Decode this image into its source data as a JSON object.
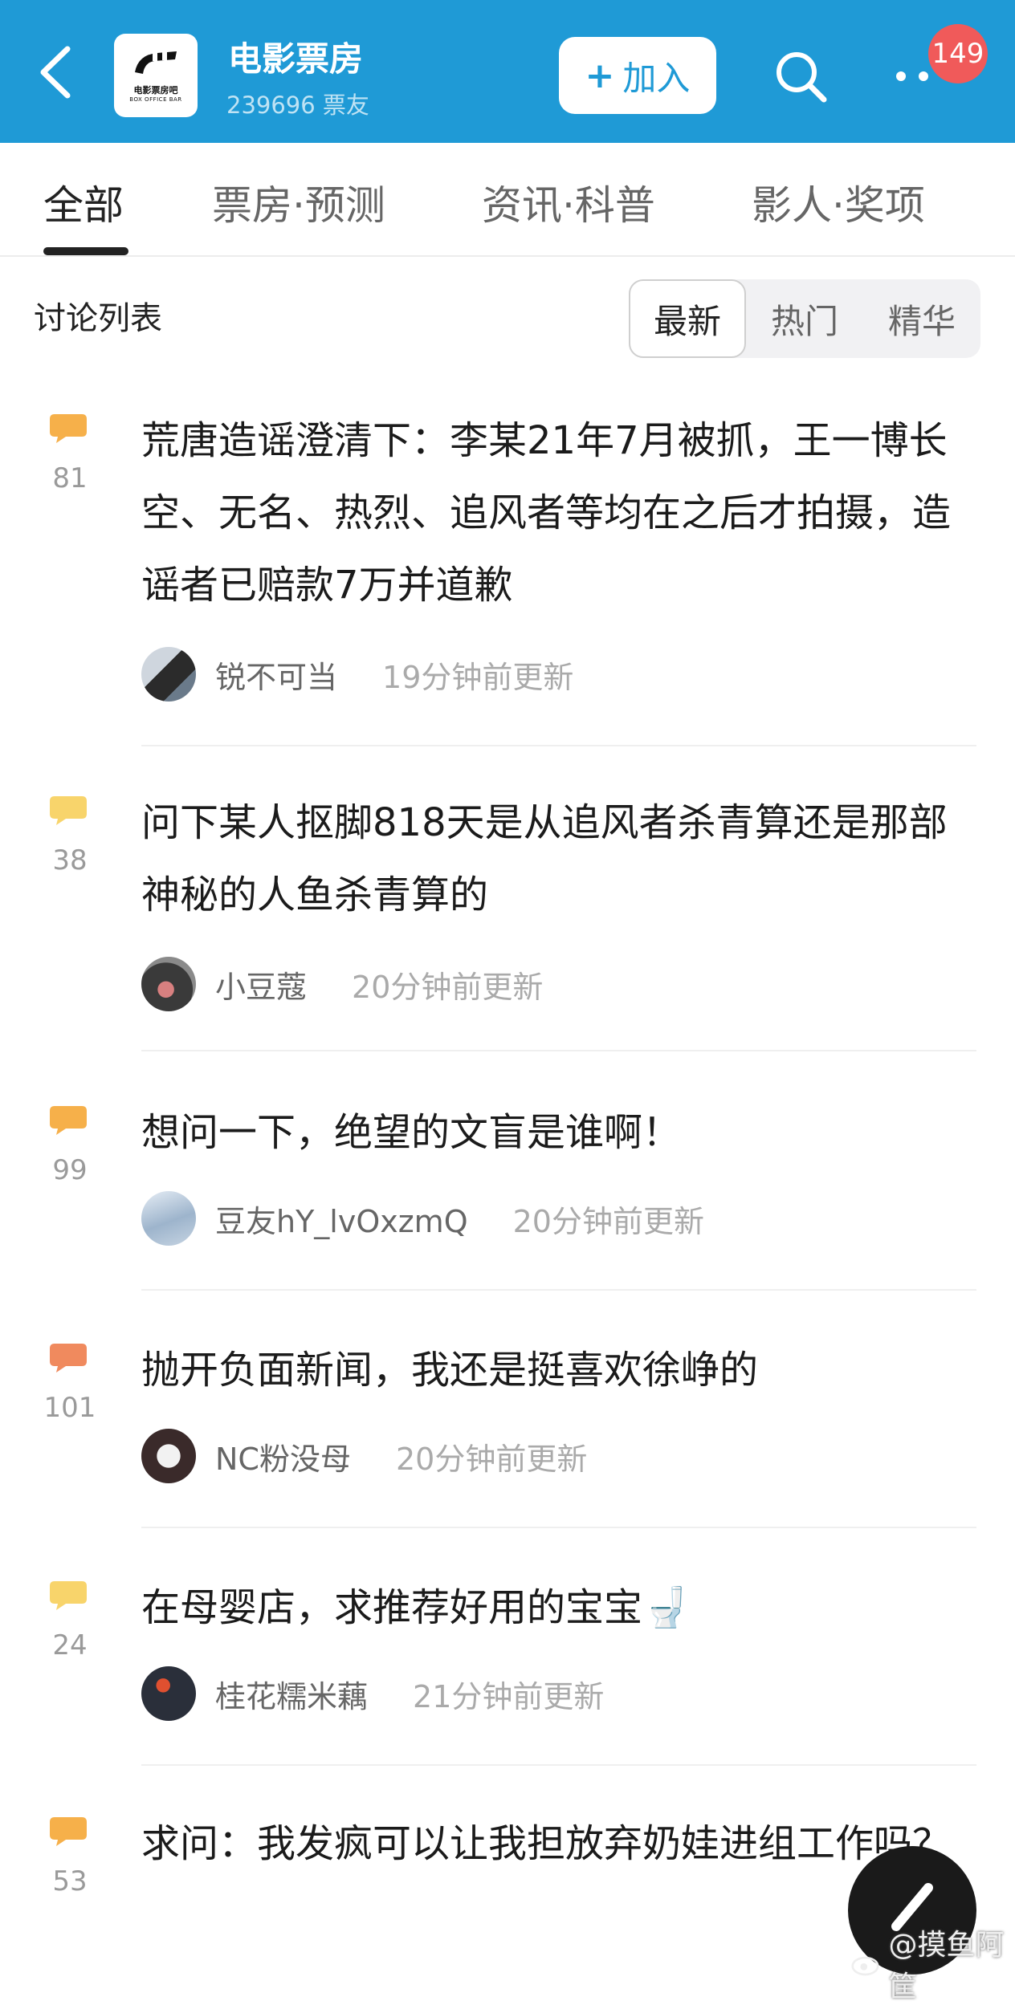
{
  "header": {
    "group_name": "电影票房",
    "member_count": "239696 票友",
    "logo_text": "电影票房吧",
    "logo_subtext": "BOX OFFICE BAR",
    "join_label": "加入",
    "join_plus": "+",
    "badge_count": "149",
    "accent_color": "#1f9ad6"
  },
  "tabs": [
    "全部",
    "票房·预测",
    "资讯·科普",
    "影人·奖项"
  ],
  "list": {
    "title": "讨论列表",
    "sort_options": [
      "最新",
      "热门",
      "精华"
    ],
    "selected_sort": "最新"
  },
  "posts": [
    {
      "title": "荒唐造谣澄清下：李某21年7月被抓，王一博长空、无名、热烈、追风者等均在之后才拍摄，造谣者已赔款7万并道歉",
      "comments": "81",
      "author": "锐不可当",
      "time": "19分钟前更新",
      "icon_color": "#f6b04a"
    },
    {
      "title": "问下某人抠脚818天是从追风者杀青算还是那部神秘的人鱼杀青算的",
      "comments": "38",
      "author": "小豆蔻",
      "time": "20分钟前更新",
      "icon_color": "#f8d46b"
    },
    {
      "title": "想问一下，绝望的文盲是谁啊！",
      "comments": "99",
      "author": "豆友hY_lvOxzmQ",
      "time": "20分钟前更新",
      "icon_color": "#f6b04a"
    },
    {
      "title": "抛开负面新闻，我还是挺喜欢徐峥的",
      "comments": "101",
      "author": "NC粉没母",
      "time": "20分钟前更新",
      "icon_color": "#f08a5e"
    },
    {
      "title": "在母婴店，求推荐好用的宝宝🚽",
      "comments": "24",
      "author": "桂花糯米藕",
      "time": "21分钟前更新",
      "icon_color": "#f8d46b"
    },
    {
      "title": "求问：我发疯可以让我担放弃奶娃进组工作吗？",
      "comments": "53",
      "author": "",
      "time": "",
      "icon_color": "#f6b04a"
    }
  ],
  "watermark": "@摸鱼阿筐"
}
